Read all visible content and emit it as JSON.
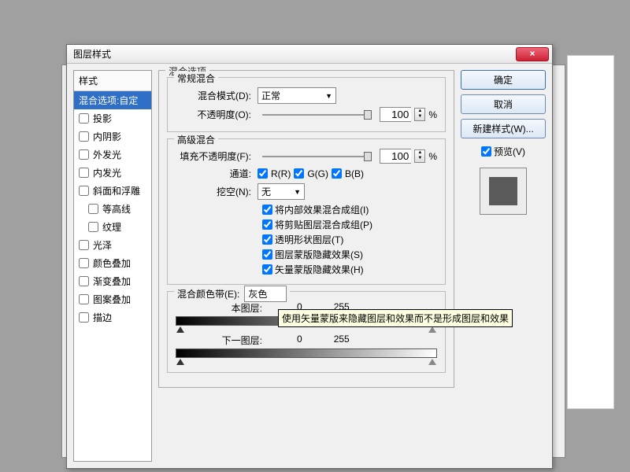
{
  "dialog": {
    "title": "图层样式",
    "close_x": "×"
  },
  "styles": {
    "header": "样式",
    "selected": "混合选项:自定",
    "items": [
      "投影",
      "内阴影",
      "外发光",
      "内发光",
      "斜面和浮雕",
      "等高线",
      "纹理",
      "光泽",
      "颜色叠加",
      "渐变叠加",
      "图案叠加",
      "描边"
    ]
  },
  "blending": {
    "options_title": "混合选项",
    "general_group": "常规混合",
    "mode_label": "混合模式(D):",
    "mode_value": "正常",
    "opacity_label": "不透明度(O):",
    "opacity_value": "100",
    "percent": "%",
    "advanced_group": "高级混合",
    "fill_label": "填充不透明度(F):",
    "fill_value": "100",
    "channels_label": "通道:",
    "ch_r": "R(R)",
    "ch_g": "G(G)",
    "ch_b": "B(B)",
    "knockout_label": "挖空(N):",
    "knockout_value": "无",
    "opts": {
      "i": "将内部效果混合成组(I)",
      "p": "将剪贴图层混合成组(P)",
      "t": "透明形状图层(T)",
      "s": "图层蒙版隐藏效果(S)",
      "h": "矢量蒙版隐藏效果(H)"
    },
    "blendif_title": "混合颜色带(E):",
    "blendif_value": "灰色",
    "this_layer": "本图层:",
    "under_layer": "下一图层:",
    "range_low": "0",
    "range_high": "255"
  },
  "buttons": {
    "ok": "确定",
    "cancel": "取消",
    "new_style": "新建样式(W)...",
    "preview": "预览(V)"
  },
  "tooltip": "使用矢量蒙版来隐藏图层和效果而不是形成图层和效果"
}
